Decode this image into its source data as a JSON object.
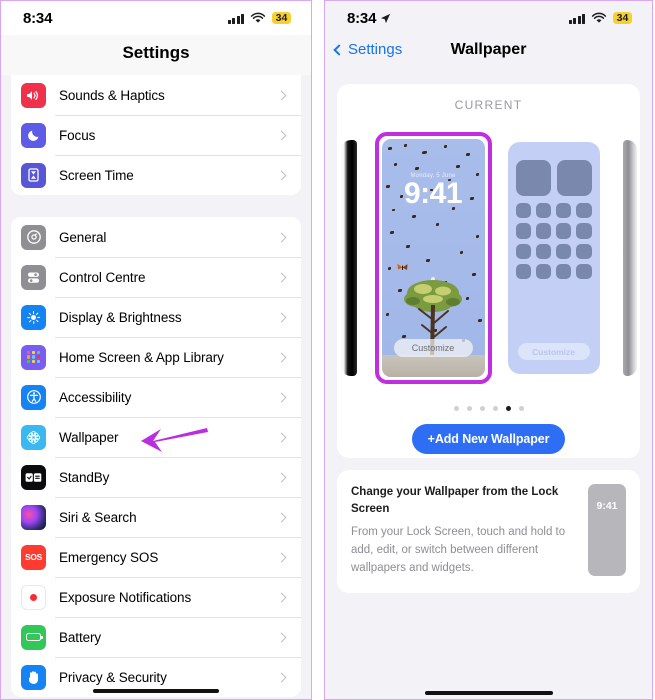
{
  "left_panel": {
    "status_bar": {
      "time": "8:34",
      "battery_percent": "34",
      "signal_icon": "cellular-bars-icon",
      "wifi_icon": "wifi-icon"
    },
    "nav_title": "Settings",
    "groups": [
      {
        "name": "group-sounds",
        "items": [
          {
            "label": "Sounds & Haptics",
            "icon": "speaker-icon",
            "icon_class": "ic-sound"
          },
          {
            "label": "Focus",
            "icon": "moon-icon",
            "icon_class": "ic-focus"
          },
          {
            "label": "Screen Time",
            "icon": "hourglass-icon",
            "icon_class": "ic-screentime"
          }
        ]
      },
      {
        "name": "group-general",
        "items": [
          {
            "label": "General",
            "icon": "gear-icon",
            "icon_class": "ic-general"
          },
          {
            "label": "Control Centre",
            "icon": "sliders-icon",
            "icon_class": "ic-control"
          },
          {
            "label": "Display & Brightness",
            "icon": "brightness-icon",
            "icon_class": "ic-display"
          },
          {
            "label": "Home Screen & App Library",
            "icon": "app-grid-icon",
            "icon_class": "ic-home"
          },
          {
            "label": "Accessibility",
            "icon": "accessibility-icon",
            "icon_class": "ic-access"
          },
          {
            "label": "Wallpaper",
            "icon": "flower-icon",
            "icon_class": "ic-wallpaper"
          },
          {
            "label": "StandBy",
            "icon": "standby-icon",
            "icon_class": "ic-standby"
          },
          {
            "label": "Siri & Search",
            "icon": "siri-orb-icon",
            "icon_class": "ic-siri"
          },
          {
            "label": "Emergency SOS",
            "icon": "sos-icon",
            "icon_class": "ic-sos"
          },
          {
            "label": "Exposure Notifications",
            "icon": "exposure-icon",
            "icon_class": "ic-exposure"
          },
          {
            "label": "Battery",
            "icon": "battery-icon",
            "icon_class": "ic-battery"
          },
          {
            "label": "Privacy & Security",
            "icon": "hand-icon",
            "icon_class": "ic-privacy"
          }
        ]
      }
    ],
    "annotation": {
      "type": "arrow",
      "points_to": "Wallpaper",
      "color": "#b92fe0"
    }
  },
  "right_panel": {
    "status_bar": {
      "time": "8:34",
      "battery_percent": "34",
      "location_icon": "location-arrow-icon"
    },
    "back_label": "Settings",
    "nav_title": "Wallpaper",
    "current_section": {
      "header": "CURRENT",
      "lock_preview": {
        "name": "lock-screen-preview",
        "clock": "9:41",
        "date": "Monday, 5 June",
        "customize_label": "Customize",
        "selected": true,
        "highlight_color": "#c12ee0"
      },
      "home_preview": {
        "name": "home-screen-preview",
        "customize_label": "Customize"
      },
      "pagination": {
        "total": 6,
        "active_index": 5
      },
      "add_button": "+Add New Wallpaper"
    },
    "tip_card": {
      "title": "Change your Wallpaper from the Lock Screen",
      "body": "From your Lock Screen, touch and hold to add, edit, or switch between different wallpapers and widgets.",
      "phone_clock": "9:41"
    }
  },
  "colors": {
    "accent_blue": "#2d6ef5",
    "link_blue": "#1775ec",
    "annotation_purple": "#b92fe0",
    "battery_yellow": "#f7cf2e"
  }
}
